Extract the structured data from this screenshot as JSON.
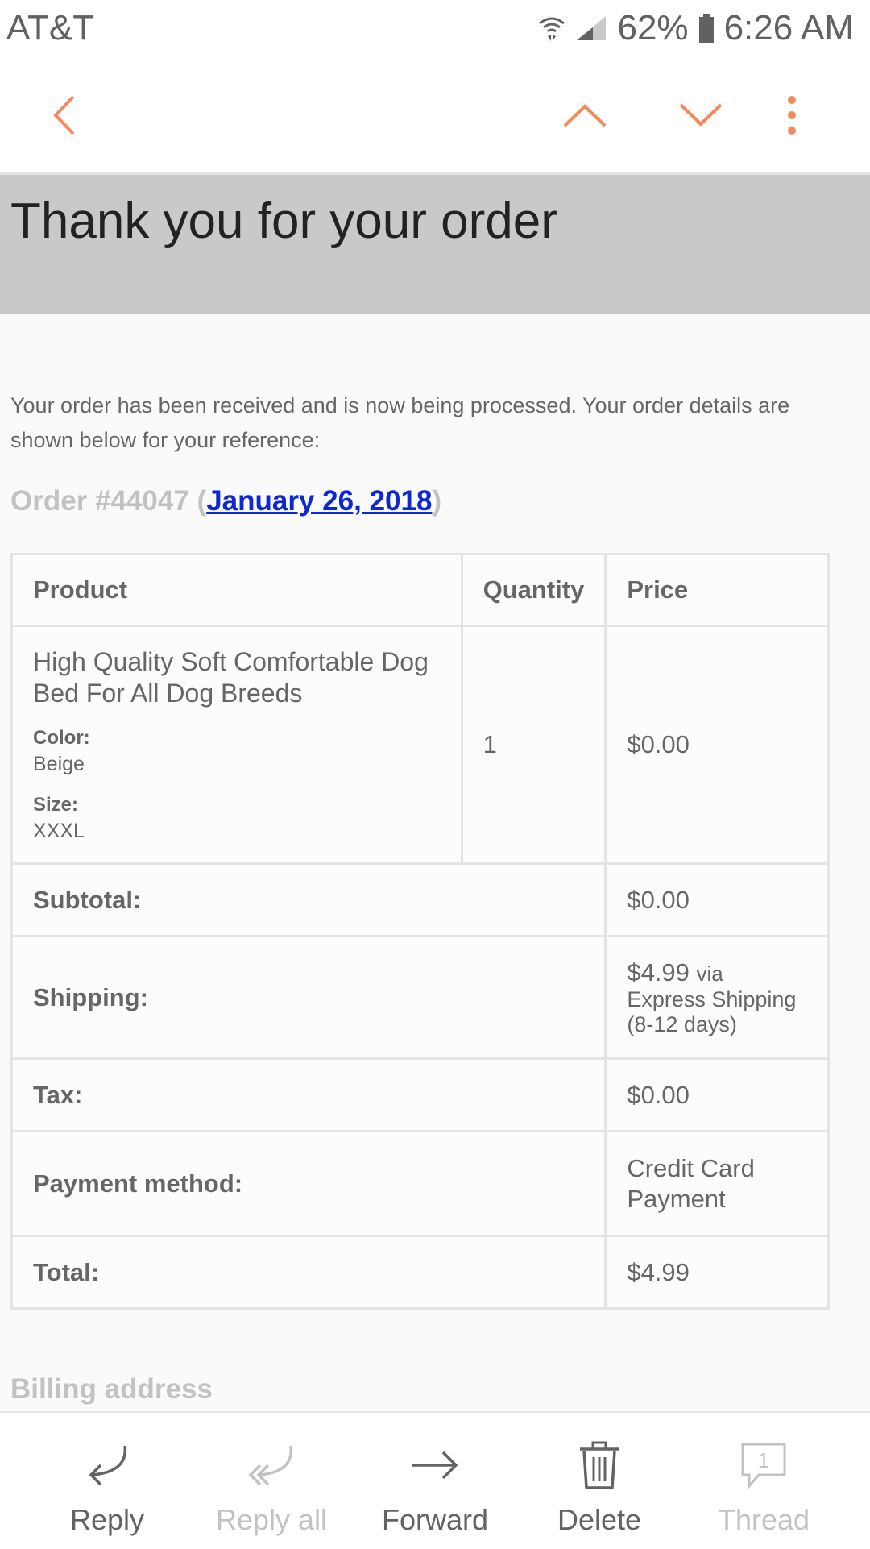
{
  "status_bar": {
    "carrier": "AT&T",
    "battery": "62%",
    "time": "6:26 AM"
  },
  "toolbar": {
    "back_icon": "chevron-left-icon",
    "prev_icon": "chevron-up-icon",
    "next_icon": "chevron-down-icon",
    "more_icon": "more-vertical-icon",
    "accent_color": "#f5895b"
  },
  "email": {
    "heading": "Thank you for your order",
    "intro": "Your order has been received and is now being processed. Your order details are shown below for your reference:",
    "order_prefix": "Order #44047 (",
    "order_date": "January 26, 2018",
    "order_suffix": ")",
    "table": {
      "headers": [
        "Product",
        "Quantity",
        "Price"
      ],
      "item": {
        "name": "High Quality Soft Comfortable Dog Bed For All Dog Breeds",
        "color_label": "Color:",
        "color_value": "Beige",
        "size_label": "Size:",
        "size_value": "XXXL",
        "quantity": "1",
        "price": "$0.00"
      },
      "totals": {
        "subtotal_label": "Subtotal:",
        "subtotal_value": "$0.00",
        "shipping_label": "Shipping:",
        "shipping_amount": "$4.99",
        "shipping_via": "via",
        "shipping_method": "Express Shipping (8-12 days)",
        "tax_label": "Tax:",
        "tax_value": "$0.00",
        "payment_label": "Payment method:",
        "payment_value": "Credit Card Payment",
        "total_label": "Total:",
        "total_value": "$4.99"
      }
    },
    "billing_heading": "Billing address"
  },
  "bottom_nav": {
    "reply": "Reply",
    "reply_all": "Reply all",
    "forward": "Forward",
    "delete": "Delete",
    "thread": "Thread",
    "thread_count": "1"
  }
}
